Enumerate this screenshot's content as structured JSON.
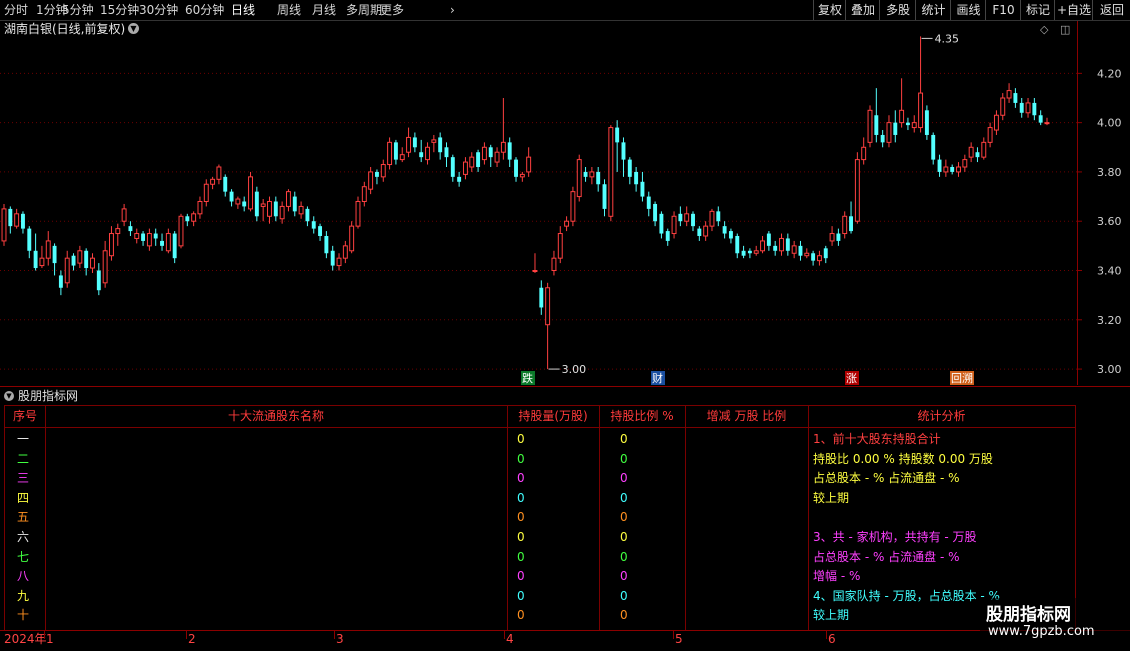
{
  "toolbar": {
    "periods": [
      "分时",
      "1分钟",
      "5分钟",
      "15分钟",
      "30分钟",
      "60分钟",
      "日线",
      "周线",
      "月线",
      "多周期",
      "更多"
    ],
    "active_period": "日线",
    "right_buttons": [
      "复权",
      "叠加",
      "多股",
      "统计",
      "画线",
      "F10",
      "标记",
      "+自选",
      "返回"
    ]
  },
  "chart": {
    "title": "湖南白银(日线,前复权)",
    "max_label": "4.35",
    "min_label": "3.00",
    "markers": [
      {
        "text": "跌",
        "bg": "#0b7a2a",
        "color": "#ffffff"
      },
      {
        "text": "财",
        "bg": "#1a4fa0",
        "color": "#ffffff"
      },
      {
        "text": "涨",
        "bg": "#b00000",
        "color": "#ffffff"
      },
      {
        "text": "回溯",
        "bg": "#d0601a",
        "color": "#ffffff"
      }
    ],
    "colors": {
      "up": "#ff4040",
      "down": "#54ffff",
      "grid": "#6b0000",
      "axis_text": "#d0d0d0"
    }
  },
  "chart_data": {
    "type": "candlestick",
    "yticks": [
      3.0,
      3.2,
      3.4,
      3.6,
      3.8,
      4.0,
      4.2
    ],
    "ylim": [
      2.98,
      4.38
    ],
    "candles": [
      [
        3.52,
        3.65,
        3.67,
        3.5
      ],
      [
        3.65,
        3.58,
        3.66,
        3.55
      ],
      [
        3.58,
        3.63,
        3.65,
        3.57
      ],
      [
        3.63,
        3.57,
        3.64,
        3.55
      ],
      [
        3.57,
        3.48,
        3.58,
        3.45
      ],
      [
        3.48,
        3.41,
        3.55,
        3.4
      ],
      [
        3.42,
        3.45,
        3.5,
        3.41
      ],
      [
        3.45,
        3.52,
        3.56,
        3.42
      ],
      [
        3.5,
        3.43,
        3.51,
        3.38
      ],
      [
        3.38,
        3.33,
        3.4,
        3.3
      ],
      [
        3.35,
        3.45,
        3.48,
        3.33
      ],
      [
        3.46,
        3.42,
        3.47,
        3.4
      ],
      [
        3.43,
        3.48,
        3.5,
        3.41
      ],
      [
        3.48,
        3.41,
        3.49,
        3.38
      ],
      [
        3.41,
        3.45,
        3.47,
        3.39
      ],
      [
        3.4,
        3.32,
        3.43,
        3.3
      ],
      [
        3.35,
        3.48,
        3.52,
        3.33
      ],
      [
        3.46,
        3.55,
        3.58,
        3.44
      ],
      [
        3.55,
        3.57,
        3.59,
        3.5
      ],
      [
        3.6,
        3.65,
        3.67,
        3.58
      ],
      [
        3.58,
        3.56,
        3.6,
        3.54
      ],
      [
        3.53,
        3.55,
        3.57,
        3.51
      ],
      [
        3.55,
        3.52,
        3.56,
        3.5
      ],
      [
        3.5,
        3.55,
        3.57,
        3.48
      ],
      [
        3.55,
        3.53,
        3.57,
        3.5
      ],
      [
        3.52,
        3.5,
        3.55,
        3.48
      ],
      [
        3.48,
        3.55,
        3.57,
        3.47
      ],
      [
        3.55,
        3.45,
        3.56,
        3.43
      ],
      [
        3.5,
        3.62,
        3.63,
        3.49
      ],
      [
        3.62,
        3.6,
        3.63,
        3.58
      ],
      [
        3.6,
        3.63,
        3.64,
        3.58
      ],
      [
        3.63,
        3.68,
        3.7,
        3.61
      ],
      [
        3.68,
        3.75,
        3.77,
        3.66
      ],
      [
        3.75,
        3.77,
        3.78,
        3.73
      ],
      [
        3.77,
        3.82,
        3.83,
        3.75
      ],
      [
        3.78,
        3.72,
        3.79,
        3.7
      ],
      [
        3.72,
        3.68,
        3.73,
        3.66
      ],
      [
        3.67,
        3.69,
        3.7,
        3.65
      ],
      [
        3.68,
        3.66,
        3.7,
        3.64
      ],
      [
        3.65,
        3.78,
        3.8,
        3.64
      ],
      [
        3.72,
        3.62,
        3.74,
        3.6
      ],
      [
        3.66,
        3.67,
        3.69,
        3.6
      ],
      [
        3.62,
        3.68,
        3.7,
        3.59
      ],
      [
        3.68,
        3.62,
        3.7,
        3.6
      ],
      [
        3.61,
        3.66,
        3.68,
        3.59
      ],
      [
        3.66,
        3.72,
        3.73,
        3.64
      ],
      [
        3.7,
        3.64,
        3.72,
        3.62
      ],
      [
        3.63,
        3.66,
        3.68,
        3.61
      ],
      [
        3.65,
        3.6,
        3.66,
        3.58
      ],
      [
        3.6,
        3.57,
        3.62,
        3.55
      ],
      [
        3.58,
        3.54,
        3.59,
        3.52
      ],
      [
        3.54,
        3.47,
        3.56,
        3.45
      ],
      [
        3.48,
        3.42,
        3.5,
        3.4
      ],
      [
        3.42,
        3.45,
        3.47,
        3.4
      ],
      [
        3.45,
        3.5,
        3.52,
        3.43
      ],
      [
        3.48,
        3.58,
        3.6,
        3.47
      ],
      [
        3.58,
        3.68,
        3.7,
        3.57
      ],
      [
        3.68,
        3.74,
        3.76,
        3.66
      ],
      [
        3.73,
        3.8,
        3.82,
        3.71
      ],
      [
        3.8,
        3.78,
        3.81,
        3.75
      ],
      [
        3.78,
        3.83,
        3.85,
        3.76
      ],
      [
        3.83,
        3.92,
        3.94,
        3.81
      ],
      [
        3.92,
        3.85,
        3.93,
        3.83
      ],
      [
        3.85,
        3.87,
        3.9,
        3.84
      ],
      [
        3.88,
        3.94,
        3.98,
        3.86
      ],
      [
        3.94,
        3.9,
        3.96,
        3.88
      ],
      [
        3.88,
        3.86,
        3.93,
        3.84
      ],
      [
        3.85,
        3.9,
        3.92,
        3.83
      ],
      [
        3.92,
        3.93,
        3.95,
        3.88
      ],
      [
        3.94,
        3.88,
        3.96,
        3.85
      ],
      [
        3.9,
        3.86,
        3.92,
        3.82
      ],
      [
        3.86,
        3.78,
        3.87,
        3.76
      ],
      [
        3.78,
        3.76,
        3.8,
        3.74
      ],
      [
        3.79,
        3.84,
        3.86,
        3.77
      ],
      [
        3.82,
        3.86,
        3.88,
        3.8
      ],
      [
        3.88,
        3.82,
        3.89,
        3.8
      ],
      [
        3.85,
        3.9,
        3.92,
        3.83
      ],
      [
        3.9,
        3.86,
        3.91,
        3.82
      ],
      [
        3.84,
        3.88,
        3.9,
        3.82
      ],
      [
        3.88,
        3.92,
        4.1,
        3.85
      ],
      [
        3.92,
        3.85,
        3.94,
        3.82
      ],
      [
        3.85,
        3.78,
        3.86,
        3.76
      ],
      [
        3.78,
        3.79,
        3.8,
        3.76
      ],
      [
        3.8,
        3.86,
        3.9,
        3.78
      ],
      [
        3.4,
        3.4,
        3.47,
        3.39
      ],
      [
        3.33,
        3.25,
        3.36,
        3.22
      ],
      [
        3.18,
        3.33,
        3.35,
        3.0
      ],
      [
        3.4,
        3.45,
        3.48,
        3.38
      ],
      [
        3.45,
        3.55,
        3.58,
        3.43
      ],
      [
        3.58,
        3.6,
        3.62,
        3.56
      ],
      [
        3.6,
        3.72,
        3.74,
        3.58
      ],
      [
        3.7,
        3.85,
        3.87,
        3.68
      ],
      [
        3.8,
        3.78,
        3.82,
        3.76
      ],
      [
        3.78,
        3.8,
        3.82,
        3.75
      ],
      [
        3.8,
        3.75,
        3.82,
        3.72
      ],
      [
        3.75,
        3.65,
        3.77,
        3.62
      ],
      [
        3.62,
        3.98,
        3.99,
        3.6
      ],
      [
        3.98,
        3.92,
        4.01,
        3.8
      ],
      [
        3.92,
        3.85,
        3.94,
        3.78
      ],
      [
        3.85,
        3.78,
        3.86,
        3.75
      ],
      [
        3.8,
        3.75,
        3.82,
        3.72
      ],
      [
        3.76,
        3.7,
        3.8,
        3.68
      ],
      [
        3.7,
        3.65,
        3.72,
        3.62
      ],
      [
        3.67,
        3.6,
        3.68,
        3.58
      ],
      [
        3.63,
        3.55,
        3.64,
        3.53
      ],
      [
        3.56,
        3.52,
        3.57,
        3.5
      ],
      [
        3.55,
        3.62,
        3.64,
        3.53
      ],
      [
        3.63,
        3.6,
        3.66,
        3.58
      ],
      [
        3.6,
        3.63,
        3.66,
        3.58
      ],
      [
        3.63,
        3.58,
        3.64,
        3.56
      ],
      [
        3.57,
        3.54,
        3.58,
        3.52
      ],
      [
        3.54,
        3.58,
        3.6,
        3.52
      ],
      [
        3.58,
        3.64,
        3.65,
        3.56
      ],
      [
        3.64,
        3.6,
        3.66,
        3.58
      ],
      [
        3.58,
        3.55,
        3.6,
        3.53
      ],
      [
        3.56,
        3.53,
        3.57,
        3.51
      ],
      [
        3.54,
        3.47,
        3.55,
        3.45
      ],
      [
        3.48,
        3.46,
        3.5,
        3.45
      ],
      [
        3.48,
        3.47,
        3.49,
        3.45
      ],
      [
        3.47,
        3.48,
        3.5,
        3.46
      ],
      [
        3.48,
        3.52,
        3.54,
        3.47
      ],
      [
        3.55,
        3.5,
        3.56,
        3.48
      ],
      [
        3.5,
        3.48,
        3.52,
        3.46
      ],
      [
        3.48,
        3.53,
        3.55,
        3.46
      ],
      [
        3.53,
        3.48,
        3.55,
        3.46
      ],
      [
        3.47,
        3.5,
        3.52,
        3.45
      ],
      [
        3.5,
        3.46,
        3.52,
        3.44
      ],
      [
        3.46,
        3.47,
        3.49,
        3.45
      ],
      [
        3.47,
        3.44,
        3.48,
        3.42
      ],
      [
        3.44,
        3.46,
        3.48,
        3.42
      ],
      [
        3.49,
        3.45,
        3.5,
        3.43
      ],
      [
        3.52,
        3.55,
        3.58,
        3.5
      ],
      [
        3.55,
        3.52,
        3.57,
        3.5
      ],
      [
        3.55,
        3.62,
        3.64,
        3.53
      ],
      [
        3.62,
        3.56,
        3.68,
        3.55
      ],
      [
        3.6,
        3.85,
        3.88,
        3.59
      ],
      [
        3.85,
        3.9,
        3.94,
        3.83
      ],
      [
        3.92,
        4.05,
        4.07,
        3.9
      ],
      [
        4.03,
        3.95,
        4.14,
        3.92
      ],
      [
        3.95,
        3.92,
        3.97,
        3.9
      ],
      [
        3.92,
        4.0,
        4.03,
        3.9
      ],
      [
        4.0,
        3.95,
        4.05,
        3.92
      ],
      [
        4.0,
        4.05,
        4.18,
        3.98
      ],
      [
        4.0,
        3.99,
        4.02,
        3.97
      ],
      [
        3.98,
        4.0,
        4.03,
        3.96
      ],
      [
        3.98,
        4.12,
        4.35,
        3.96
      ],
      [
        4.05,
        3.95,
        4.07,
        3.93
      ],
      [
        3.95,
        3.85,
        3.96,
        3.83
      ],
      [
        3.85,
        3.8,
        3.87,
        3.78
      ],
      [
        3.8,
        3.82,
        3.85,
        3.78
      ],
      [
        3.82,
        3.8,
        3.83,
        3.79
      ],
      [
        3.8,
        3.82,
        3.84,
        3.78
      ],
      [
        3.82,
        3.85,
        3.87,
        3.8
      ],
      [
        3.86,
        3.9,
        3.92,
        3.84
      ],
      [
        3.88,
        3.86,
        3.9,
        3.84
      ],
      [
        3.86,
        3.92,
        3.94,
        3.85
      ],
      [
        3.92,
        3.98,
        4.0,
        3.9
      ],
      [
        3.97,
        4.03,
        4.05,
        3.95
      ],
      [
        4.03,
        4.1,
        4.12,
        4.01
      ],
      [
        4.1,
        4.13,
        4.16,
        4.08
      ],
      [
        4.12,
        4.08,
        4.14,
        4.06
      ],
      [
        4.08,
        4.04,
        4.1,
        4.02
      ],
      [
        4.04,
        4.08,
        4.1,
        4.02
      ],
      [
        4.08,
        4.03,
        4.1,
        4.01
      ],
      [
        4.03,
        4.0,
        4.05,
        3.99
      ],
      [
        4.0,
        4.0,
        4.02,
        3.99
      ]
    ],
    "xticks": [
      "2024年",
      "1",
      "2",
      "3",
      "4",
      "5",
      "6"
    ]
  },
  "indicator": {
    "name": "股朋指标网"
  },
  "table": {
    "headers": [
      "序号",
      "十大流通股东名称",
      "持股量(万股)",
      "持股比例 %",
      "增减 万股 比例",
      "统计分析"
    ],
    "rows": [
      {
        "seq": "一",
        "color": "#e8e8e8",
        "qty": "0",
        "qty_color": "#ffff40",
        "pct": "0",
        "pct_color": "#ffff40"
      },
      {
        "seq": "二",
        "color": "#40ff40",
        "qty": "0",
        "qty_color": "#40ff40",
        "pct": "0",
        "pct_color": "#40ff40"
      },
      {
        "seq": "三",
        "color": "#ff40ff",
        "qty": "0",
        "qty_color": "#ff40ff",
        "pct": "0",
        "pct_color": "#ff40ff"
      },
      {
        "seq": "四",
        "color": "#ffff40",
        "qty": "0",
        "qty_color": "#40ffff",
        "pct": "0",
        "pct_color": "#40ffff"
      },
      {
        "seq": "五",
        "color": "#ff9020",
        "qty": "0",
        "qty_color": "#ff9020",
        "pct": "0",
        "pct_color": "#ff9020"
      },
      {
        "seq": "六",
        "color": "#e8e8e8",
        "qty": "0",
        "qty_color": "#ffff40",
        "pct": "0",
        "pct_color": "#ffff40"
      },
      {
        "seq": "七",
        "color": "#40ff40",
        "qty": "0",
        "qty_color": "#40ff40",
        "pct": "0",
        "pct_color": "#40ff40"
      },
      {
        "seq": "八",
        "color": "#ff40ff",
        "qty": "0",
        "qty_color": "#ff40ff",
        "pct": "0",
        "pct_color": "#ff40ff"
      },
      {
        "seq": "九",
        "color": "#ffff40",
        "qty": "0",
        "qty_color": "#40ffff",
        "pct": "0",
        "pct_color": "#40ffff"
      },
      {
        "seq": "十",
        "color": "#ff9020",
        "qty": "0",
        "qty_color": "#ff9020",
        "pct": "0",
        "pct_color": "#ff9020"
      }
    ],
    "stats": [
      {
        "text": "1、前十大股东持股合计",
        "color": "#ff4040"
      },
      {
        "text": " 持股比 0.00 %   持股数 0.00 万股",
        "color": "#ffff40"
      },
      {
        "text": " 占总股本 - %   占流通盘 - %",
        "color": "#ffff40"
      },
      {
        "text": " 较上期",
        "color": "#ffff40"
      },
      {
        "text": "",
        "color": "#ffff40"
      },
      {
        "text": "3、共 - 家机构，共持有 - 万股",
        "color": "#ff40ff"
      },
      {
        "text": " 占总股本 - %   占流通盘 - %",
        "color": "#ff40ff"
      },
      {
        "text": " 增幅 - %",
        "color": "#ff40ff"
      },
      {
        "text": "4、国家队持 - 万股，占总股本 - %",
        "color": "#40ffff"
      },
      {
        "text": " 较上期",
        "color": "#40ffff"
      }
    ]
  },
  "watermark": {
    "title": "股朋指标网",
    "url": "www.7gpzb.com"
  }
}
